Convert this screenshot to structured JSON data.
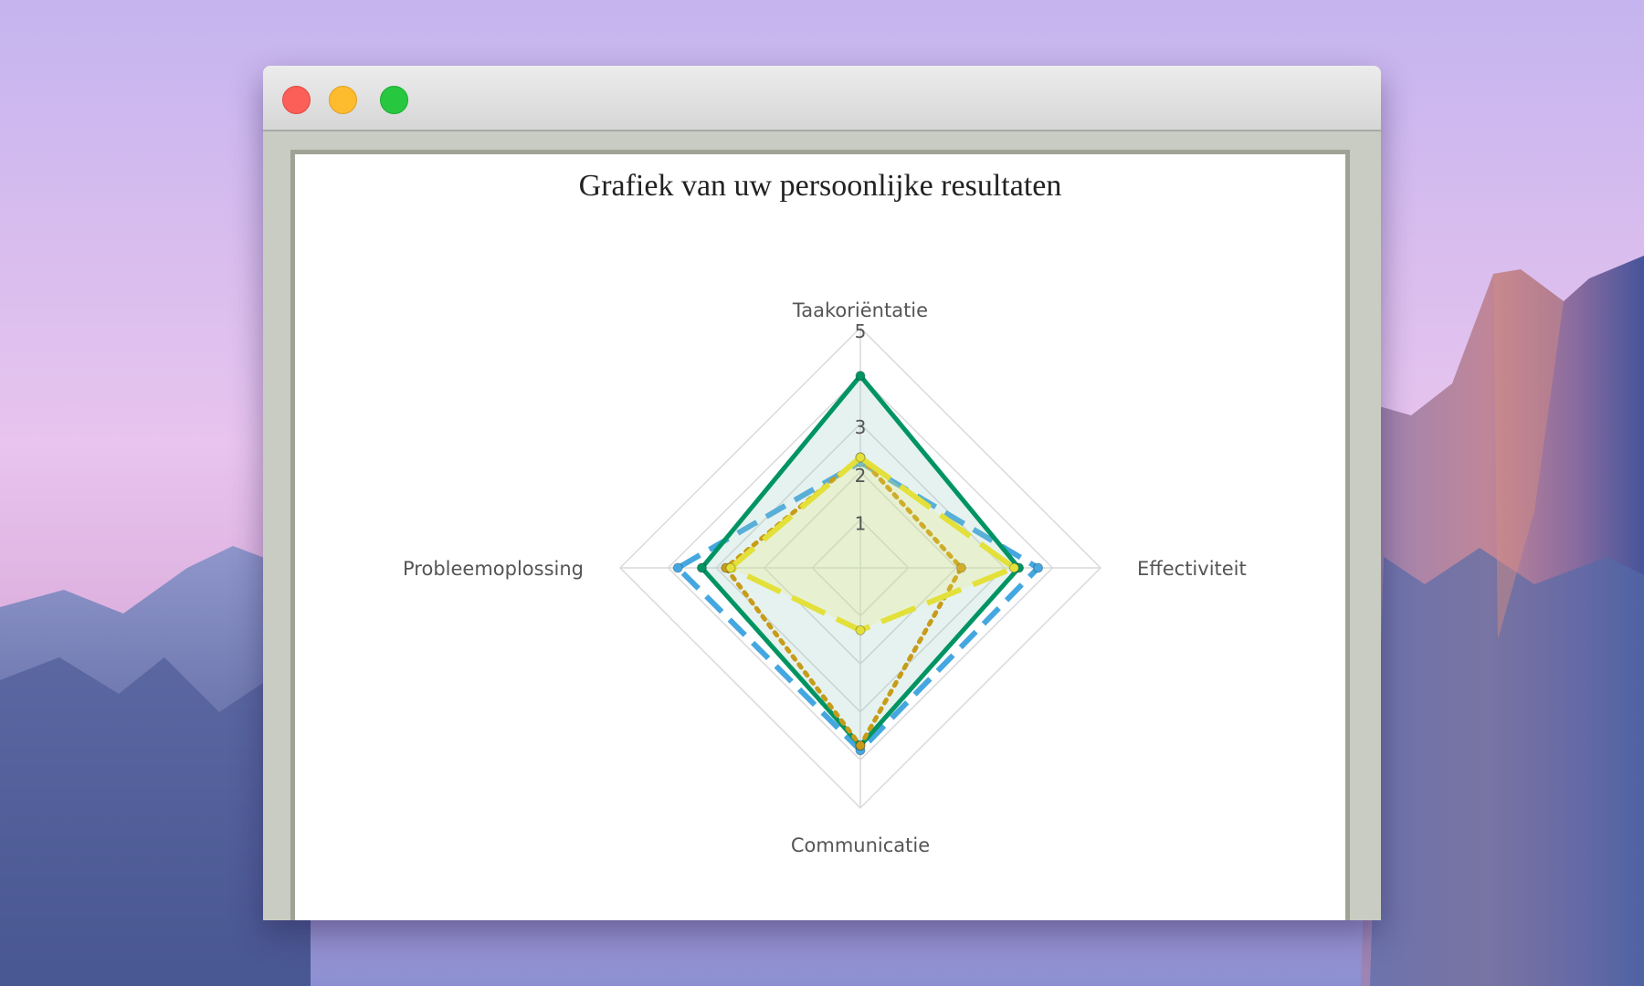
{
  "window": {
    "controls": [
      "close-button",
      "minimize-button",
      "zoom-button"
    ]
  },
  "colors": {
    "window_bg": "#c9ccc2",
    "frame_border": "#9fa395",
    "grid": "#d9d9d9",
    "label": "#555555"
  },
  "chart_data": {
    "type": "radar",
    "title": "Grafiek van uw persoonlijke resultaten",
    "axes": [
      "Taakoriëntatie",
      "Effectiviteit",
      "Communicatie",
      "Probleemoplossing"
    ],
    "radial_range": [
      0,
      5
    ],
    "radial_ticks": [
      "1",
      "2",
      "3",
      "5"
    ],
    "radial_tick_values": [
      1,
      2,
      3,
      5
    ],
    "grid": true,
    "legend": false,
    "series": [
      {
        "values": [
          2.2,
          3.7,
          3.8,
          3.8
        ],
        "color": "#45a7e0",
        "dash": "dash",
        "fill": false,
        "width": 6
      },
      {
        "values": [
          4.0,
          3.3,
          3.7,
          3.3
        ],
        "color": "#009463",
        "dash": "solid",
        "fill": "rgba(150,200,190,0.24)",
        "width": 5
      },
      {
        "values": [
          2.3,
          2.1,
          3.7,
          2.8
        ],
        "color": "#c79c18",
        "dash": "dot",
        "fill": false,
        "width": 5
      },
      {
        "values": [
          2.3,
          3.2,
          1.3,
          2.7
        ],
        "color": "#e3e03a",
        "dash": "longdash",
        "fill": "rgba(238,238,110,0.22)",
        "width": 6
      }
    ]
  }
}
